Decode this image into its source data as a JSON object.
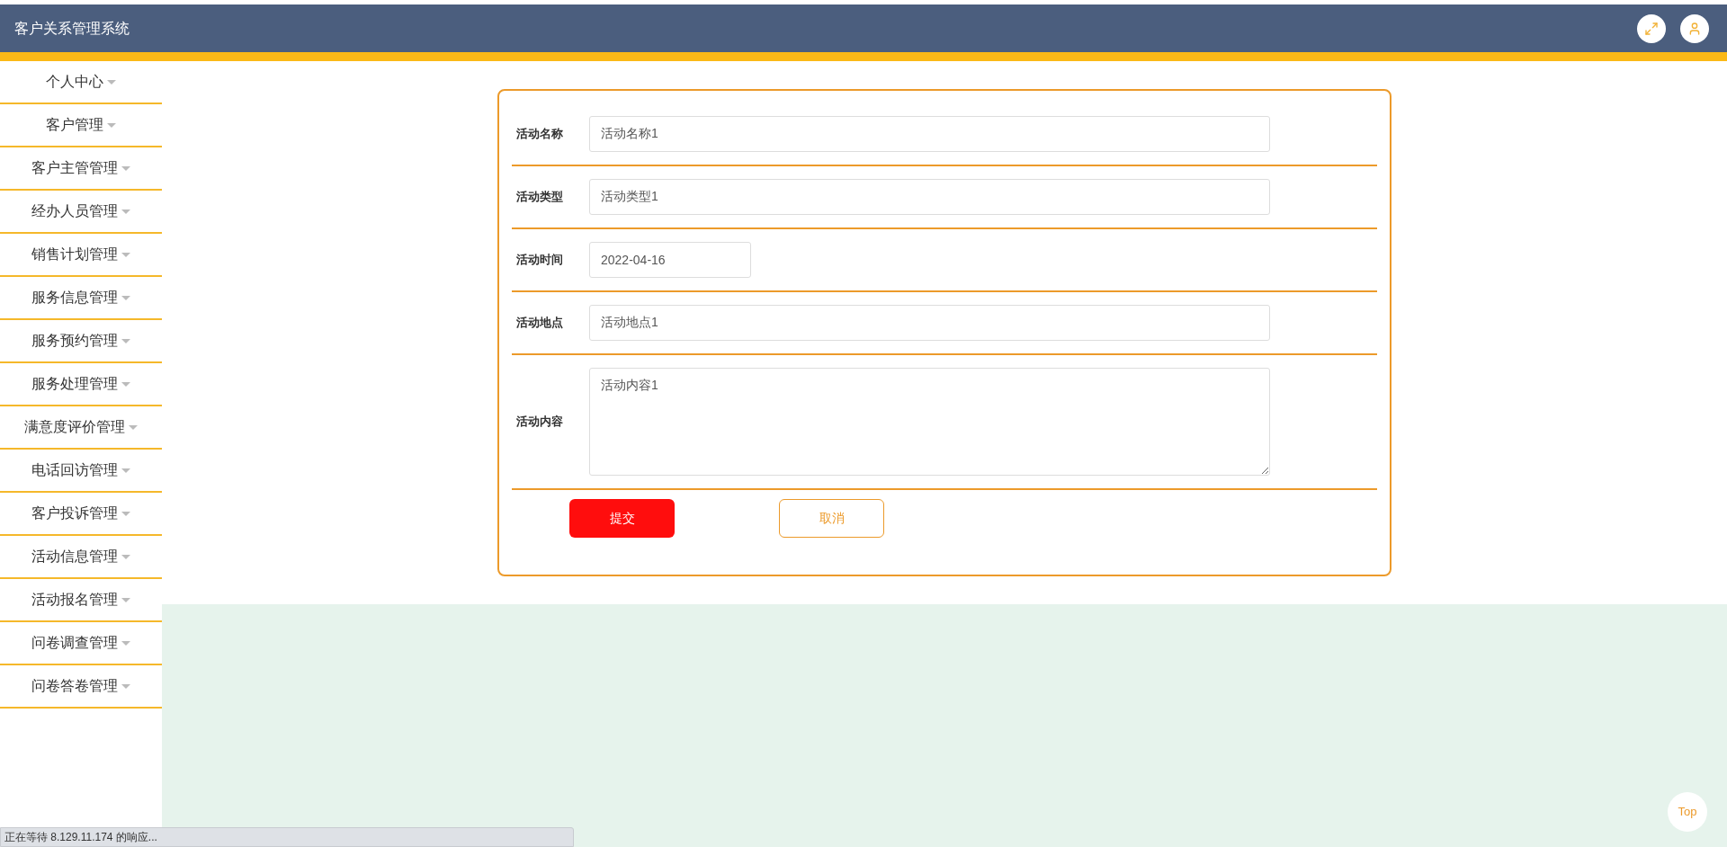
{
  "header": {
    "title": "客户关系管理系统"
  },
  "sidebar": {
    "items": [
      {
        "label": "个人中心"
      },
      {
        "label": "客户管理"
      },
      {
        "label": "客户主管管理"
      },
      {
        "label": "经办人员管理"
      },
      {
        "label": "销售计划管理"
      },
      {
        "label": "服务信息管理"
      },
      {
        "label": "服务预约管理"
      },
      {
        "label": "服务处理管理"
      },
      {
        "label": "满意度评价管理"
      },
      {
        "label": "电话回访管理"
      },
      {
        "label": "客户投诉管理"
      },
      {
        "label": "活动信息管理"
      },
      {
        "label": "活动报名管理"
      },
      {
        "label": "问卷调查管理"
      },
      {
        "label": "问卷答卷管理"
      }
    ]
  },
  "form": {
    "fields": [
      {
        "label": "活动名称",
        "kind": "text",
        "value": "活动名称1"
      },
      {
        "label": "活动类型",
        "kind": "text",
        "value": "活动类型1"
      },
      {
        "label": "活动时间",
        "kind": "date",
        "value": "2022-04-16"
      },
      {
        "label": "活动地点",
        "kind": "text",
        "value": "活动地点1"
      },
      {
        "label": "活动内容",
        "kind": "textarea",
        "value": "活动内容1"
      }
    ],
    "submit": "提交",
    "cancel": "取消"
  },
  "top_button": "Top",
  "status_bar": "正在等待 8.129.11.174 的响应..."
}
